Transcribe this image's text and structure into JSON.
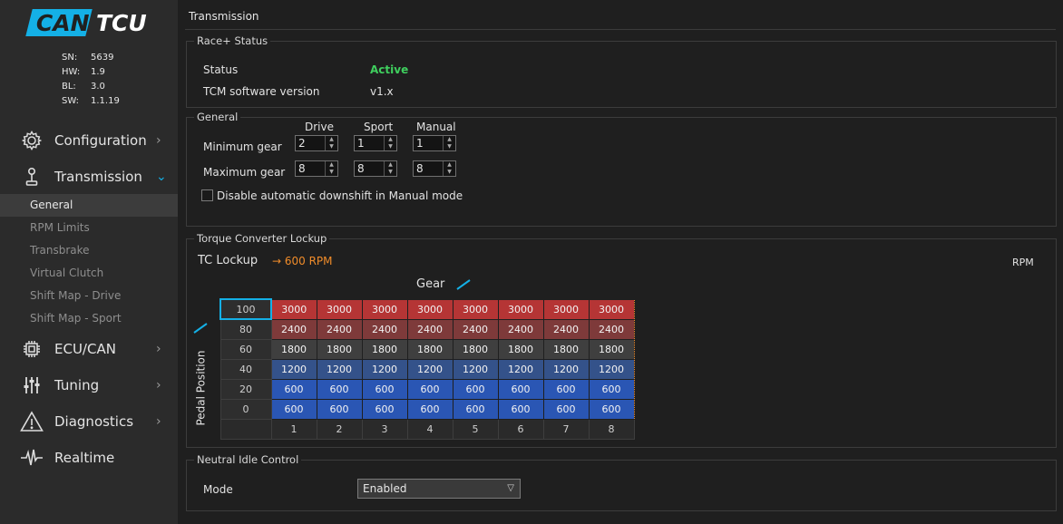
{
  "logo": {
    "part1": "CAN",
    "part2": "TCU"
  },
  "device": [
    {
      "key": "SN:",
      "value": "5639"
    },
    {
      "key": "HW:",
      "value": "1.9"
    },
    {
      "key": "BL:",
      "value": "3.0"
    },
    {
      "key": "SW:",
      "value": "1.1.19"
    }
  ],
  "nav": {
    "configuration": "Configuration",
    "transmission": "Transmission",
    "ecu_can": "ECU/CAN",
    "tuning": "Tuning",
    "diagnostics": "Diagnostics",
    "realtime": "Realtime",
    "chevron_right": "›",
    "chevron_down": "⌄"
  },
  "subnav": [
    "General",
    "RPM Limits",
    "Transbrake",
    "Virtual Clutch",
    "Shift Map - Drive",
    "Shift Map - Sport"
  ],
  "page": {
    "title": "Transmission"
  },
  "race_status": {
    "title": "Race+ Status",
    "status_label": "Status",
    "status_value": "Active",
    "status_color": "#3fcf5e",
    "version_label": "TCM software version",
    "version_value": "v1.x"
  },
  "general": {
    "title": "General",
    "col_drive": "Drive",
    "col_sport": "Sport",
    "col_manual": "Manual",
    "min_label": "Minimum gear",
    "max_label": "Maximum gear",
    "min": {
      "drive": "2",
      "sport": "1",
      "manual": "1"
    },
    "max": {
      "drive": "8",
      "sport": "8",
      "manual": "8"
    },
    "checkbox_label": "Disable automatic downshift in Manual mode",
    "checkbox_checked": false
  },
  "tc": {
    "title": "Torque Converter Lockup",
    "lockup_label": "TC Lockup",
    "lockup_value": "→ 600 RPM",
    "lockup_color": "#f08c2a",
    "unit": "RPM",
    "axis_x": "Gear",
    "axis_y": "Pedal Position",
    "accent": "#14b0e6",
    "row_headers": [
      "100",
      "80",
      "60",
      "40",
      "20",
      "0"
    ],
    "col_headers": [
      "1",
      "2",
      "3",
      "4",
      "5",
      "6",
      "7",
      "8"
    ],
    "rows": [
      [
        "3000",
        "3000",
        "3000",
        "3000",
        "3000",
        "3000",
        "3000",
        "3000"
      ],
      [
        "2400",
        "2400",
        "2400",
        "2400",
        "2400",
        "2400",
        "2400",
        "2400"
      ],
      [
        "1800",
        "1800",
        "1800",
        "1800",
        "1800",
        "1800",
        "1800",
        "1800"
      ],
      [
        "1200",
        "1200",
        "1200",
        "1200",
        "1200",
        "1200",
        "1200",
        "1200"
      ],
      [
        "600",
        "600",
        "600",
        "600",
        "600",
        "600",
        "600",
        "600"
      ],
      [
        "600",
        "600",
        "600",
        "600",
        "600",
        "600",
        "600",
        "600"
      ]
    ],
    "row_colors": [
      "#b53535",
      "#7e3a3a",
      "#3f3f3f",
      "#34528a",
      "#2a56b4",
      "#2a56b4"
    ]
  },
  "neutral": {
    "title": "Neutral Idle Control",
    "mode_label": "Mode",
    "mode_value": "Enabled"
  }
}
